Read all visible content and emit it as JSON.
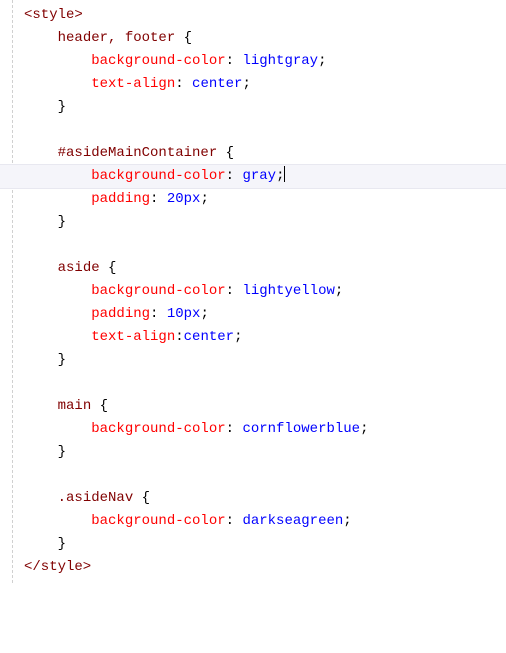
{
  "style_open": "<style>",
  "style_close": "</style>",
  "rules": [
    {
      "selector": "header, footer",
      "decls": [
        {
          "prop": "background-color",
          "val": "lightgray"
        },
        {
          "prop": "text-align",
          "val": "center"
        }
      ],
      "space_after_colon": [
        true,
        true
      ]
    },
    {
      "selector": "#asideMainContainer",
      "decls": [
        {
          "prop": "background-color",
          "val": "gray"
        },
        {
          "prop": "padding",
          "val": "20px"
        }
      ],
      "space_after_colon": [
        true,
        true
      ],
      "caret_after_decl_index": 0
    },
    {
      "selector": "aside",
      "decls": [
        {
          "prop": "background-color",
          "val": "lightyellow"
        },
        {
          "prop": "padding",
          "val": "10px"
        },
        {
          "prop": "text-align",
          "val": "center"
        }
      ],
      "space_after_colon": [
        true,
        true,
        false
      ]
    },
    {
      "selector": "main",
      "decls": [
        {
          "prop": "background-color",
          "val": "cornflowerblue"
        }
      ],
      "space_after_colon": [
        true
      ]
    },
    {
      "selector": ".asideNav",
      "decls": [
        {
          "prop": "background-color",
          "val": "darkseagreen"
        }
      ],
      "space_after_colon": [
        true
      ]
    }
  ]
}
